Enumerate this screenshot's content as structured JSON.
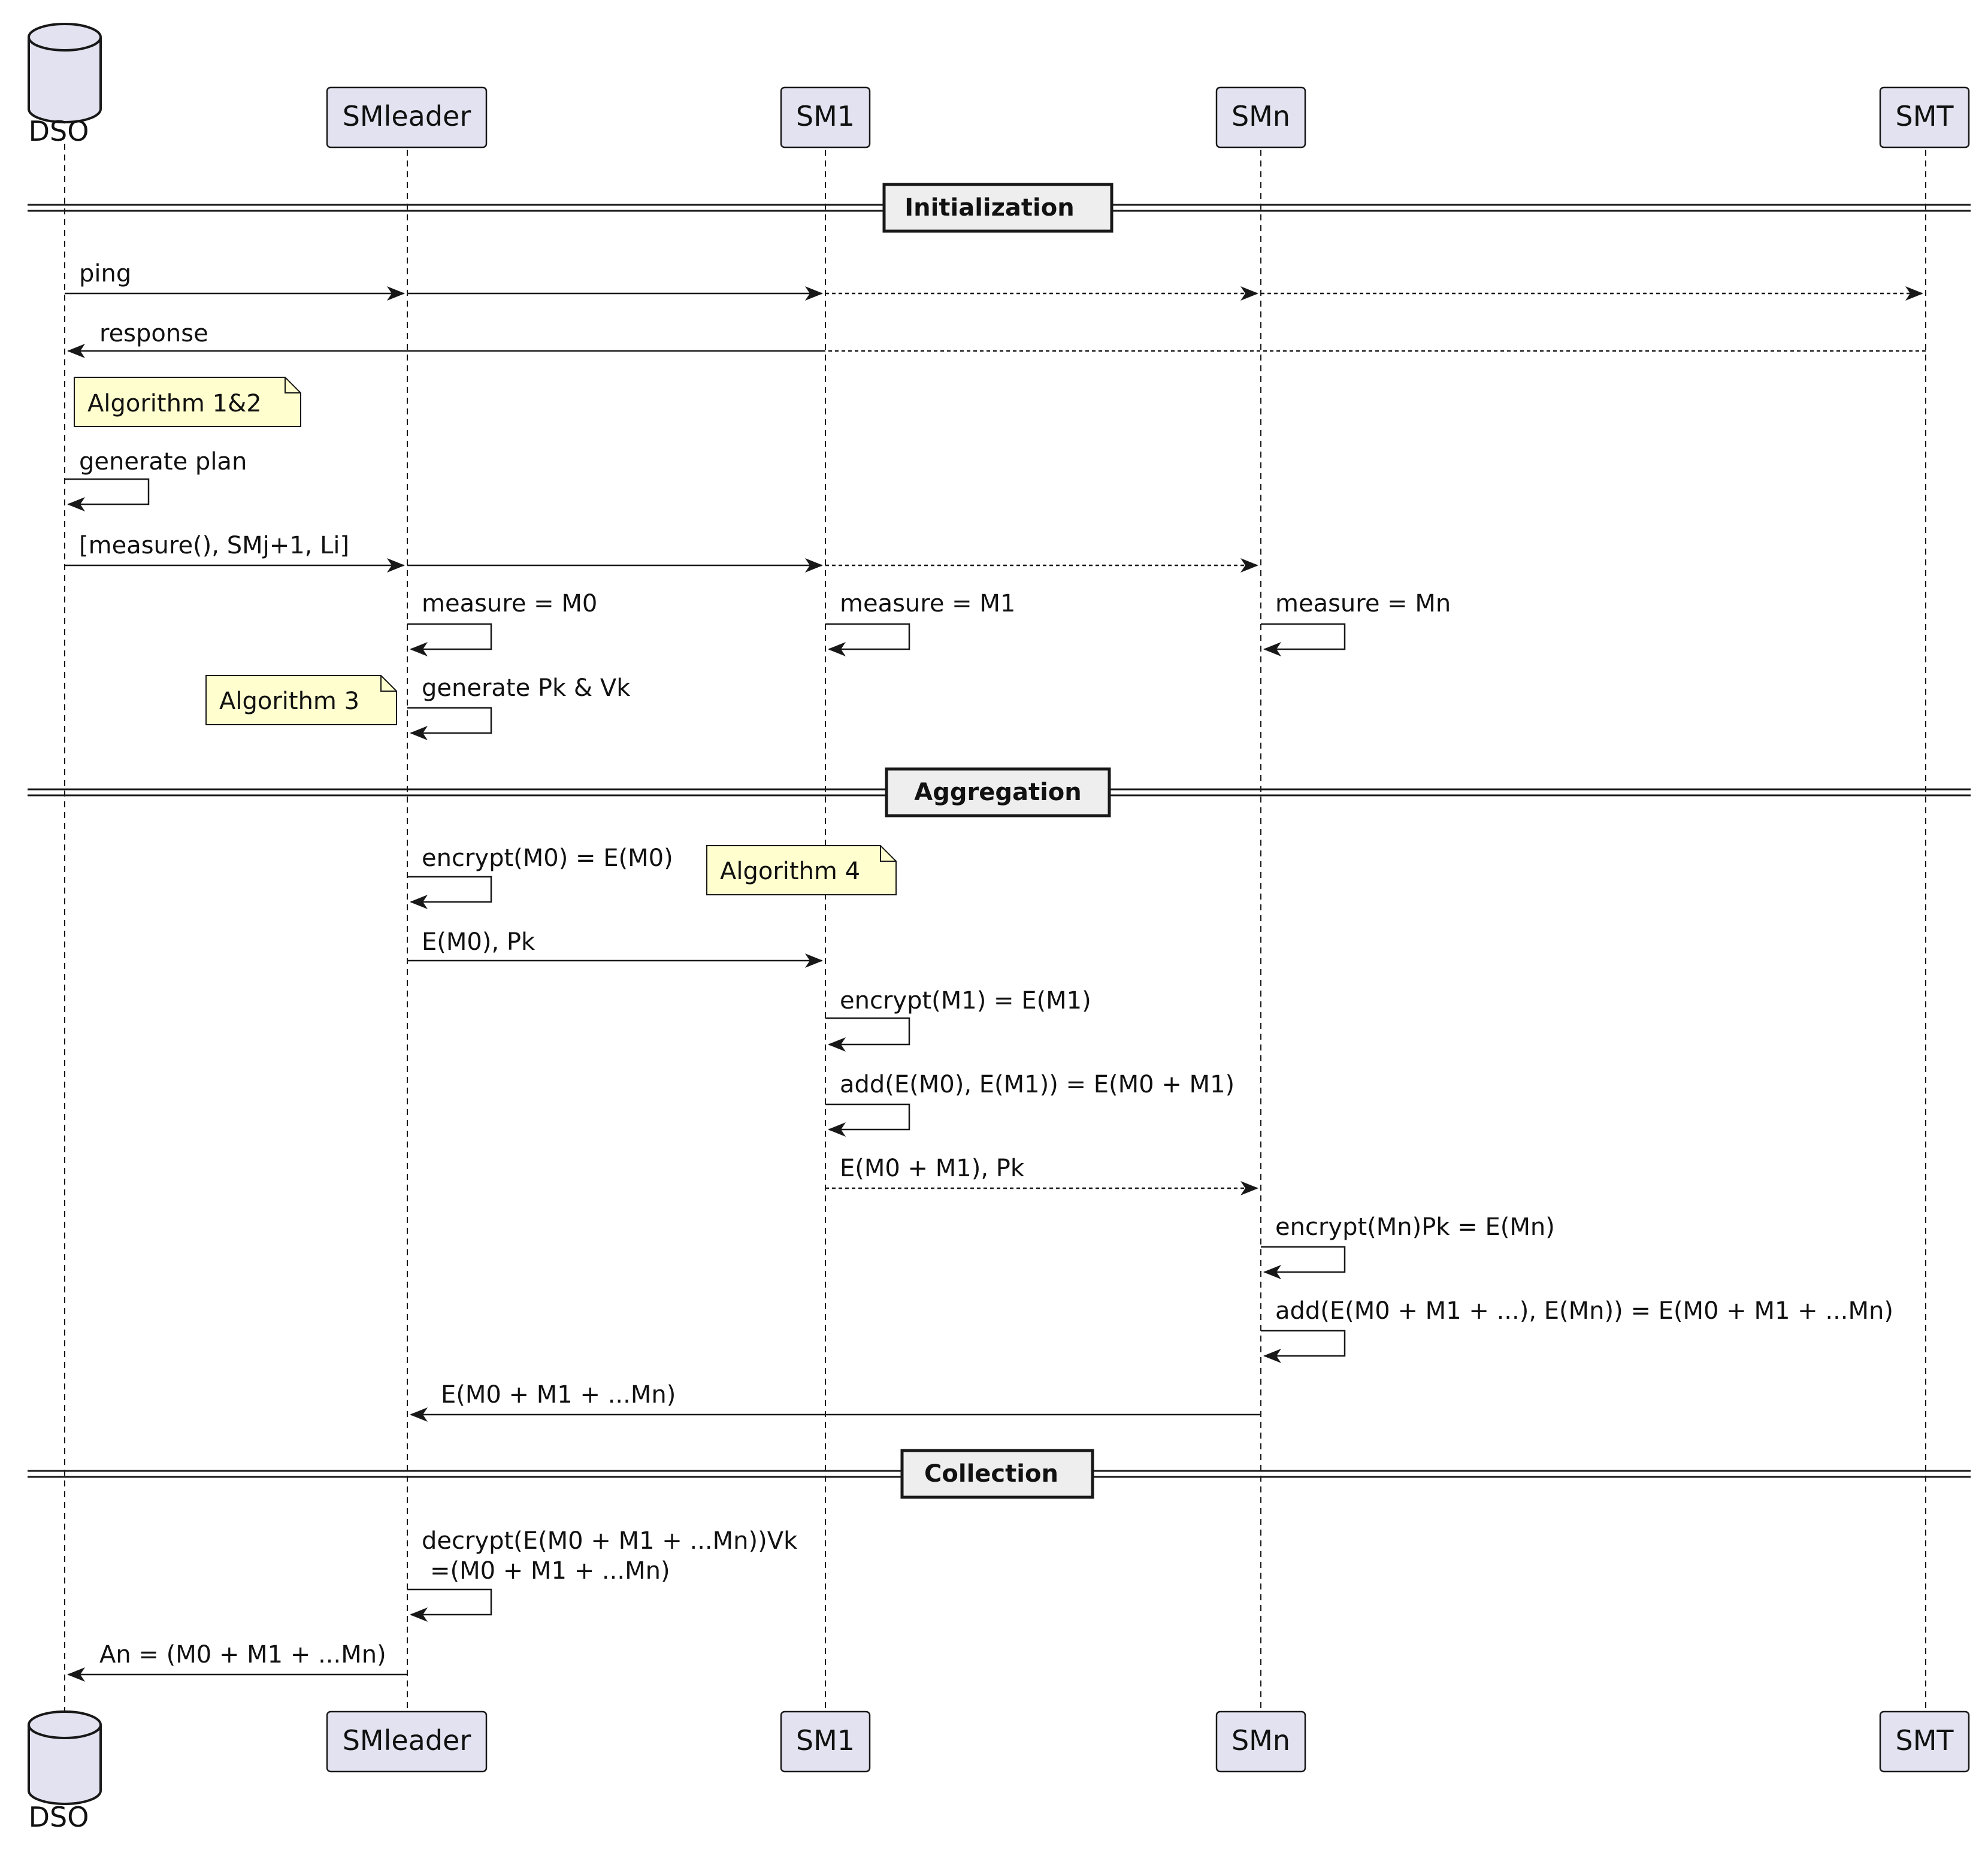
{
  "participants": [
    {
      "id": "dso",
      "label": "DSO",
      "kind": "database"
    },
    {
      "id": "smleader",
      "label": "SMleader",
      "kind": "box"
    },
    {
      "id": "sm1",
      "label": "SM1",
      "kind": "box"
    },
    {
      "id": "smn",
      "label": "SMn",
      "kind": "box"
    },
    {
      "id": "smt",
      "label": "SMT",
      "kind": "box"
    }
  ],
  "dividers": [
    {
      "label": "Initialization"
    },
    {
      "label": "Aggregation"
    },
    {
      "label": "Collection"
    }
  ],
  "notes": [
    {
      "label": "Algorithm 1&2"
    },
    {
      "label": "Algorithm 3"
    },
    {
      "label": "Algorithm 4"
    }
  ],
  "messages": [
    {
      "label": "ping",
      "from": "dso",
      "to": "smt"
    },
    {
      "label": "response",
      "from": "smt",
      "to": "dso"
    },
    {
      "label": "generate plan",
      "from": "dso",
      "to": "dso"
    },
    {
      "label": "[measure(), SMj+1, Li]",
      "from": "dso",
      "to": "smn"
    },
    {
      "label": "measure = M0",
      "from": "smleader",
      "to": "smleader"
    },
    {
      "label": "measure = M1",
      "from": "sm1",
      "to": "sm1"
    },
    {
      "label": "measure = Mn",
      "from": "smn",
      "to": "smn"
    },
    {
      "label": "generate Pk & Vk",
      "from": "smleader",
      "to": "smleader"
    },
    {
      "label": "encrypt(M0) = E(M0)",
      "from": "smleader",
      "to": "smleader"
    },
    {
      "label": "E(M0), Pk",
      "from": "smleader",
      "to": "sm1"
    },
    {
      "label": "encrypt(M1) = E(M1)",
      "from": "sm1",
      "to": "sm1"
    },
    {
      "label": "add(E(M0), E(M1)) = E(M0 + M1)",
      "from": "sm1",
      "to": "sm1"
    },
    {
      "label": "E(M0 + M1), Pk",
      "from": "sm1",
      "to": "smn"
    },
    {
      "label": "encrypt(Mn)Pk = E(Mn)",
      "from": "smn",
      "to": "smn"
    },
    {
      "label": "add(E(M0 + M1 + ...), E(Mn)) = E(M0 + M1 + ...Mn)",
      "from": "smn",
      "to": "smn"
    },
    {
      "label": "E(M0 + M1 + ...Mn)",
      "from": "smn",
      "to": "smleader"
    },
    {
      "label": "decrypt(E(M0 + M1 + ...Mn))Vk",
      "label2": "=(M0 + M1 + ...Mn)",
      "from": "smleader",
      "to": "smleader"
    },
    {
      "label": "An = (M0 + M1 + ...Mn)",
      "from": "smleader",
      "to": "dso"
    }
  ],
  "colors": {
    "participant_fill": "#e2e2f0",
    "participant_stroke": "#181818",
    "note_fill": "#fefece",
    "divider_fill": "#eeeeee",
    "line": "#181818"
  }
}
